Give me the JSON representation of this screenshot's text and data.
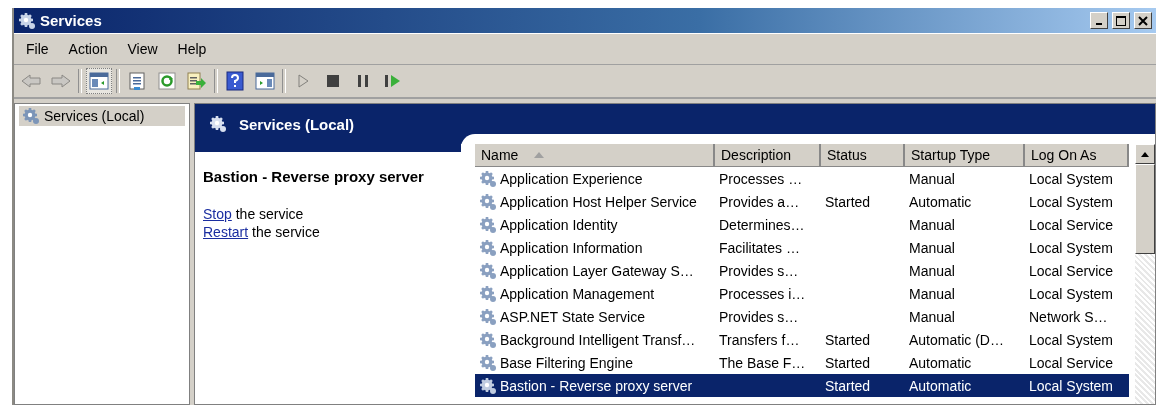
{
  "window": {
    "title": "Services"
  },
  "menu": [
    "File",
    "Action",
    "View",
    "Help"
  ],
  "toolbar": [
    [
      {
        "kind": "back",
        "disabled": true,
        "pressed": false
      },
      {
        "kind": "forward",
        "disabled": true,
        "pressed": false
      }
    ],
    [
      {
        "kind": "tree",
        "disabled": false,
        "pressed": true
      }
    ],
    [
      {
        "kind": "properties",
        "disabled": false,
        "pressed": false
      },
      {
        "kind": "refresh",
        "disabled": false,
        "pressed": false
      },
      {
        "kind": "export",
        "disabled": false,
        "pressed": false
      }
    ],
    [
      {
        "kind": "help",
        "disabled": false,
        "pressed": false
      },
      {
        "kind": "actionpane",
        "disabled": false,
        "pressed": false
      }
    ],
    [
      {
        "kind": "play",
        "disabled": true,
        "pressed": false
      },
      {
        "kind": "stop",
        "disabled": false,
        "pressed": false
      },
      {
        "kind": "pause",
        "disabled": false,
        "pressed": false
      },
      {
        "kind": "resume",
        "disabled": false,
        "pressed": false
      }
    ]
  ],
  "tree": [
    {
      "label": "Services (Local)",
      "selected": true
    }
  ],
  "pane": {
    "title": "Services (Local)"
  },
  "details": {
    "title": "Bastion - Reverse proxy server",
    "actions": [
      {
        "link": "Stop",
        "text": "the service"
      },
      {
        "link": "Restart",
        "text": "the service"
      }
    ]
  },
  "table": {
    "columns": [
      "Name",
      "Description",
      "Status",
      "Startup Type",
      "Log On As"
    ],
    "rows": [
      {
        "name": "Application Experience",
        "description": "Processes …",
        "startup": "Manual",
        "logon": "Local System",
        "selected": false
      },
      {
        "name": "Application Host Helper Service",
        "description": "Provides a…",
        "status": "Started",
        "startup": "Automatic",
        "logon": "Local System",
        "selected": false
      },
      {
        "name": "Application Identity",
        "description": "Determines…",
        "startup": "Manual",
        "logon": "Local Service",
        "selected": false
      },
      {
        "name": "Application Information",
        "description": "Facilitates …",
        "startup": "Manual",
        "logon": "Local System",
        "selected": false
      },
      {
        "name": "Application Layer Gateway S…",
        "description": "Provides s…",
        "startup": "Manual",
        "logon": "Local Service",
        "selected": false
      },
      {
        "name": "Application Management",
        "description": "Processes i…",
        "startup": "Manual",
        "logon": "Local System",
        "selected": false
      },
      {
        "name": "ASP.NET State Service",
        "description": "Provides s…",
        "startup": "Manual",
        "logon": "Network S…",
        "selected": false
      },
      {
        "name": "Background Intelligent Transf…",
        "description": "Transfers f…",
        "status": "Started",
        "startup": "Automatic (D…",
        "logon": "Local System",
        "selected": false
      },
      {
        "name": "Base Filtering Engine",
        "description": "The Base F…",
        "status": "Started",
        "startup": "Automatic",
        "logon": "Local Service",
        "selected": false
      },
      {
        "name": "Bastion - Reverse proxy server",
        "status": "Started",
        "startup": "Automatic",
        "logon": "Local System",
        "selected": true
      }
    ]
  }
}
